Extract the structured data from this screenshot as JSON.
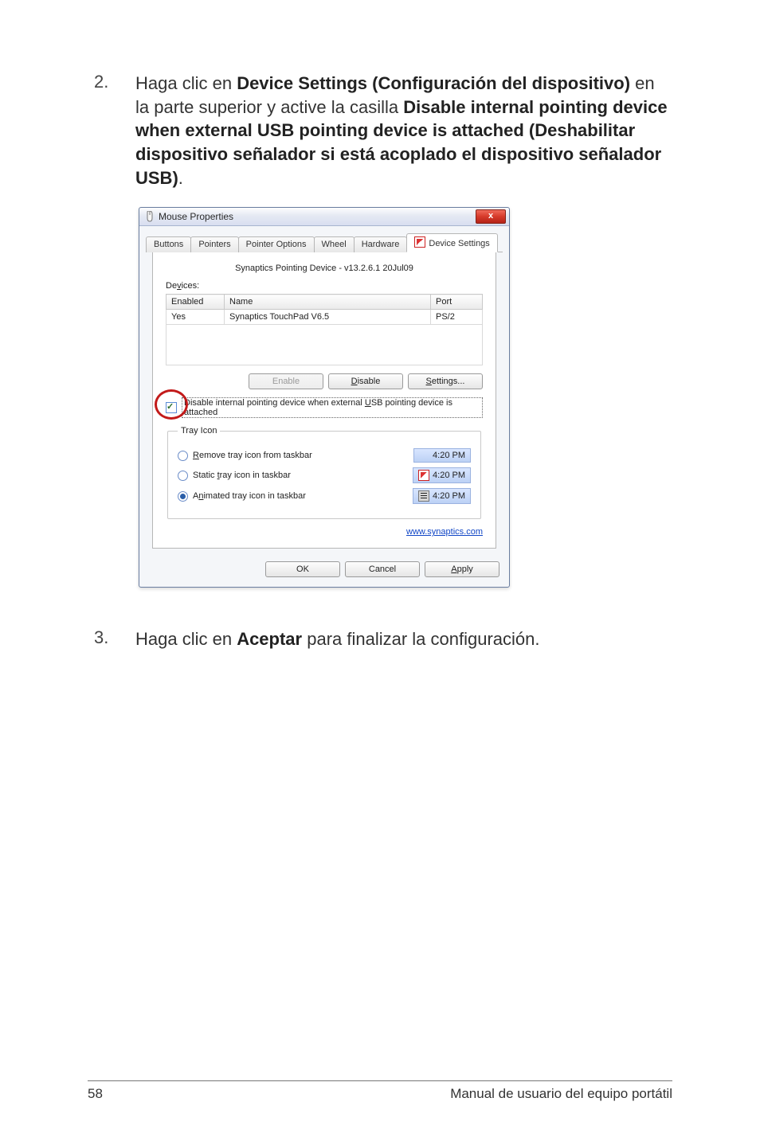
{
  "step2": {
    "num": "2.",
    "pre": "Haga clic en ",
    "b1": "Device Settings (Configuración del dispositivo)",
    "mid1": " en la parte superior y active la casilla ",
    "b2": "Disable internal pointing device when external USB pointing device is attached (Deshabilitar dispositivo señalador si está acoplado el dispositivo señalador USB)",
    "end": "."
  },
  "step3": {
    "num": "3.",
    "pre": "Haga clic en ",
    "b1": "Aceptar",
    "end": " para finalizar la configuración."
  },
  "dialog": {
    "title": "Mouse Properties",
    "close_glyph": "x",
    "tabs": {
      "buttons": "Buttons",
      "pointers": "Pointers",
      "pointer_options": "Pointer Options",
      "wheel": "Wheel",
      "hardware": "Hardware",
      "device_settings": "Device Settings"
    },
    "version_line": "Synaptics Pointing Device - v13.2.6.1 20Jul09",
    "devices_label": "Devices:",
    "table": {
      "col_enabled": "Enabled",
      "col_name": "Name",
      "col_port": "Port",
      "row_enabled": "Yes",
      "row_name": "Synaptics TouchPad V6.5",
      "row_port": "PS/2"
    },
    "buttons_row": {
      "enable": "Enable",
      "disable": "Disable",
      "settings": "Settings..."
    },
    "checkbox_label_pre": "Dis",
    "checkbox_label_rest": "able internal pointing device when external ",
    "checkbox_label_u": "U",
    "checkbox_label_after": "SB pointing device is attached",
    "tray": {
      "legend": "Tray Icon",
      "remove_r": "R",
      "remove_rest": "emove tray icon from taskbar",
      "static_pre": "Static ",
      "static_t": "t",
      "static_rest": "ray icon in taskbar",
      "anim_a": "A",
      "anim_n": "n",
      "anim_rest": "imated tray icon in taskbar",
      "time": "4:20 PM"
    },
    "link": "www.synaptics.com",
    "ok": "OK",
    "cancel": "Cancel",
    "apply_a": "A",
    "apply_rest": "pply",
    "disable_d": "D",
    "settings_s": "S"
  },
  "footer": {
    "page": "58",
    "title": "Manual de usuario del equipo portátil"
  }
}
